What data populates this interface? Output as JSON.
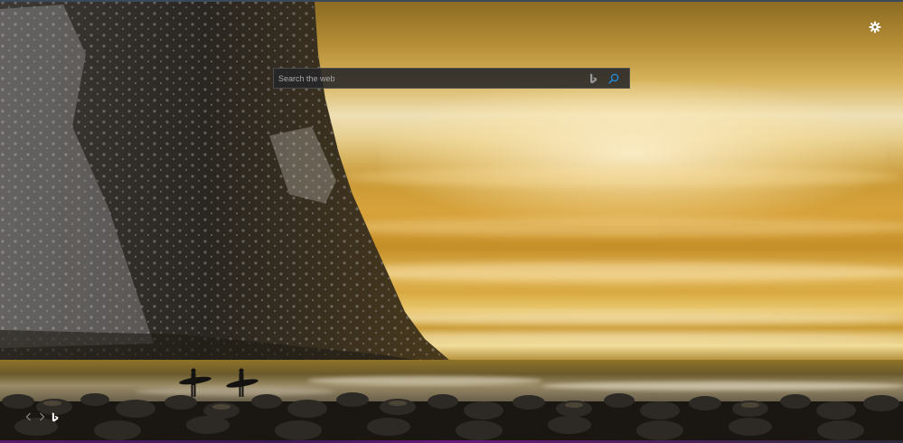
{
  "search": {
    "placeholder": "Search the web"
  },
  "icons": {
    "settings": "gear-icon",
    "bing": "bing-logo-icon",
    "search": "magnifier-icon",
    "previous": "chevron-left-icon",
    "next": "chevron-right-icon",
    "wallpaper_brand": "bing-logo-icon"
  },
  "colors": {
    "search_icon": "#1f8ad6",
    "search_box_bg": "#262628",
    "icon_light": "#ffffff",
    "icon_muted": "#9a9a9a"
  }
}
